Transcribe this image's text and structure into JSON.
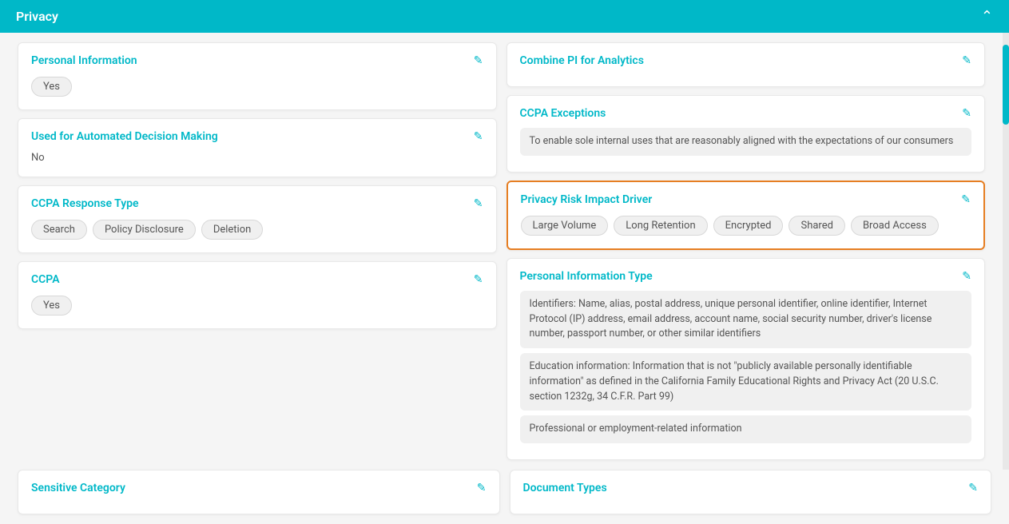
{
  "header": {
    "title": "Privacy",
    "collapse_label": "collapse"
  },
  "left_column": [
    {
      "id": "personal-information",
      "title": "Personal Information",
      "type": "tags",
      "values": [
        "Yes"
      ]
    },
    {
      "id": "automated-decision-making",
      "title": "Used for Automated Decision Making",
      "type": "text",
      "values": [
        "No"
      ]
    },
    {
      "id": "ccpa-response-type",
      "title": "CCPA Response Type",
      "type": "tags",
      "values": [
        "Search",
        "Policy Disclosure",
        "Deletion"
      ]
    },
    {
      "id": "ccpa",
      "title": "CCPA",
      "type": "tags",
      "values": [
        "Yes"
      ]
    }
  ],
  "right_column": [
    {
      "id": "combine-pi-analytics",
      "title": "Combine PI for Analytics",
      "type": "text",
      "values": [],
      "highlighted": false
    },
    {
      "id": "ccpa-exceptions",
      "title": "CCPA Exceptions",
      "type": "text-block",
      "values": [
        "To enable sole internal uses that are reasonably aligned with the expectations of our consumers"
      ],
      "highlighted": false
    },
    {
      "id": "privacy-risk-impact-driver",
      "title": "Privacy Risk Impact Driver",
      "type": "tags",
      "values": [
        "Large Volume",
        "Long Retention",
        "Encrypted",
        "Shared",
        "Broad Access"
      ],
      "highlighted": true
    },
    {
      "id": "personal-information-type",
      "title": "Personal Information Type",
      "type": "text-blocks",
      "values": [
        "Identifiers: Name, alias, postal address, unique personal identifier, online identifier, Internet Protocol (IP) address, email address, account name, social security number, driver's license number, passport number, or other similar identifiers",
        "Education information: Information that is not \"publicly available personally identifiable information\" as defined in the California Family Educational Rights and Privacy Act (20 U.S.C. section 1232g, 34 C.F.R. Part 99)",
        "Professional or employment-related information"
      ],
      "highlighted": false
    }
  ],
  "bottom_left": {
    "id": "sensitive-category",
    "title": "Sensitive Category"
  },
  "bottom_right": {
    "id": "document-types",
    "title": "Document Types"
  },
  "icons": {
    "edit": "✎",
    "chevron_up": "∧"
  }
}
